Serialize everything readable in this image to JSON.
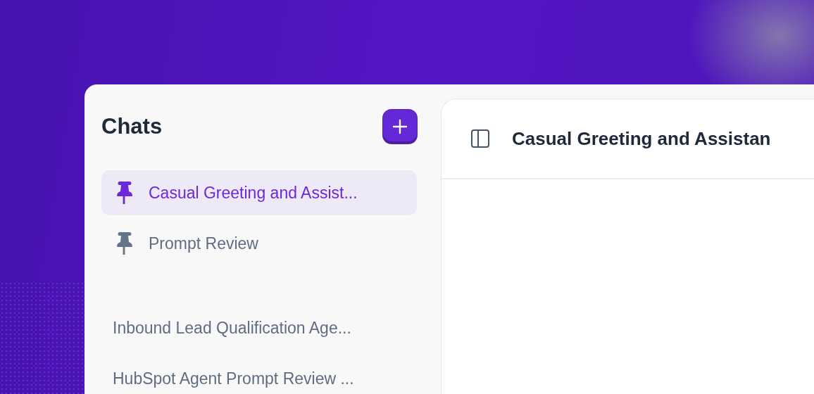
{
  "sidebar": {
    "title": "Chats",
    "chats": [
      {
        "kind": "pinned",
        "title": "Casual Greeting and Assist...",
        "selected": true
      },
      {
        "kind": "pinned",
        "title": "Prompt Review",
        "selected": false
      },
      {
        "kind": "recent",
        "title": "Inbound Lead Qualification Age...",
        "selected": false
      },
      {
        "kind": "recent",
        "title": "HubSpot Agent Prompt Review ...",
        "selected": false
      }
    ]
  },
  "main": {
    "title": "Casual Greeting and Assistan"
  }
}
